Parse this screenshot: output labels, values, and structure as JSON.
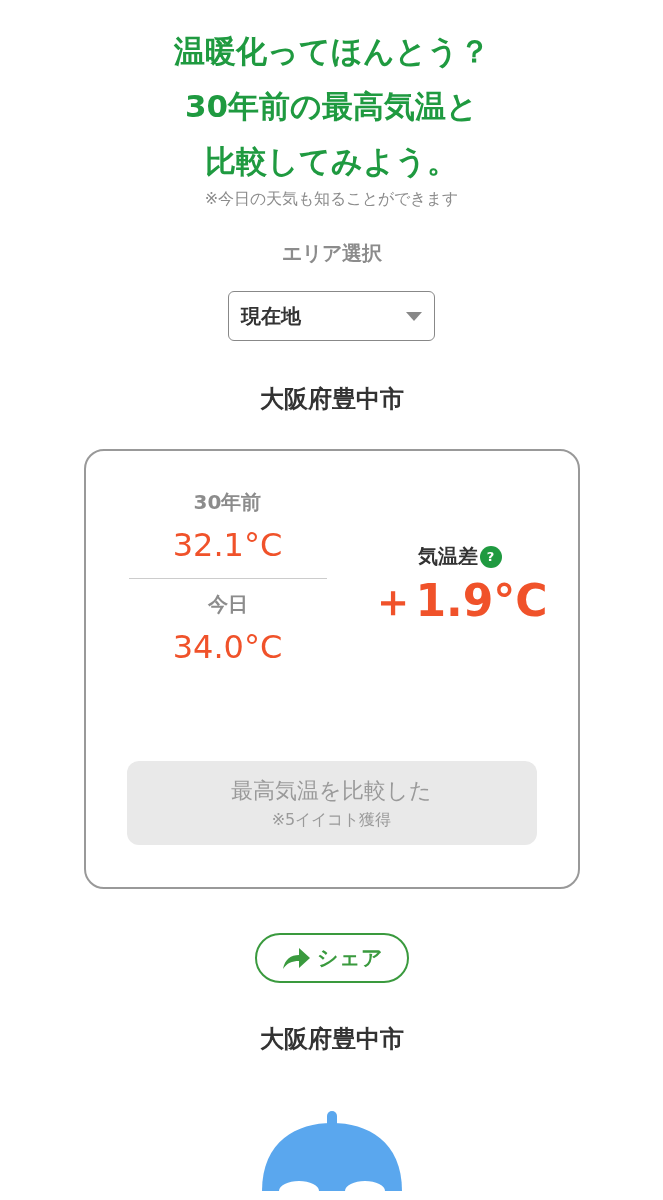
{
  "title_lines": [
    "温暖化ってほんとう？",
    "30年前の最高気温と",
    "比較してみよう。"
  ],
  "note": "※今日の天気も知ることができます",
  "area": {
    "label": "エリア選択",
    "select": {
      "value": "現在地"
    }
  },
  "city": "大阪府豊中市",
  "comparison": {
    "past": {
      "label": "30年前",
      "value": "32.1°C"
    },
    "today": {
      "label": "今日",
      "value": "34.0°C"
    },
    "diff": {
      "label": "気温差",
      "help": "?",
      "value": "＋1.9°C"
    },
    "compare_button": {
      "label": "最高気温を比較した",
      "sub": "※5イイコト獲得",
      "disabled": true
    }
  },
  "share_button": {
    "label": "シェア"
  },
  "city_2": "大阪府豊中市"
}
